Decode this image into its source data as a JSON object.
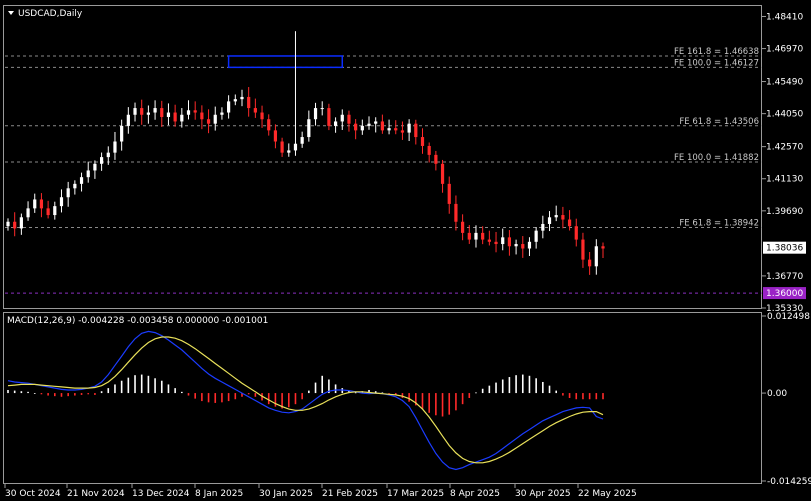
{
  "chart_data": [
    {
      "type": "candlestick",
      "symbol_label": "USDCAD,Daily",
      "ylim": [
        1.3533,
        1.4888
      ],
      "y_ticks": [
        "1.48410",
        "1.46970",
        "1.45490",
        "1.44050",
        "1.42570",
        "1.41130",
        "1.39690",
        "1.36770",
        "1.35330"
      ],
      "x_ticks": [
        "30 Oct 2024",
        "21 Nov 2024",
        "13 Dec 2024",
        "8 Jan 2025",
        "30 Jan 2025",
        "21 Feb 2025",
        "17 Mar 2025",
        "8 Apr 2025",
        "30 Apr 2025",
        "22 May 2025"
      ],
      "current_price": "1.38036",
      "level_marker": "1.36000",
      "fibonacci_levels": [
        {
          "label": "FE 161.8 = 1.46638",
          "value": 1.46638
        },
        {
          "label": "FE 100.0 = 1.46127",
          "value": 1.46127
        },
        {
          "label": "FE 61.8 = 1.43506",
          "value": 1.43506
        },
        {
          "label": "FE 100.0 = 1.41882",
          "value": 1.41882
        },
        {
          "label": "FE 61.8 = 1.38942",
          "value": 1.38942
        }
      ],
      "target_zone": {
        "from": 1.46127,
        "to": 1.46638
      },
      "close_path": [
        1.392,
        1.389,
        1.394,
        1.398,
        1.402,
        1.398,
        1.395,
        1.399,
        1.403,
        1.407,
        1.409,
        1.412,
        1.415,
        1.418,
        1.421,
        1.423,
        1.428,
        1.435,
        1.44,
        1.443,
        1.44,
        1.441,
        1.443,
        1.439,
        1.441,
        1.437,
        1.44,
        1.442,
        1.441,
        1.438,
        1.436,
        1.44,
        1.441,
        1.446,
        1.447,
        1.448,
        1.443,
        1.441,
        1.438,
        1.433,
        1.428,
        1.423,
        1.424,
        1.427,
        1.43,
        1.438,
        1.443,
        1.443,
        1.435,
        1.437,
        1.44,
        1.436,
        1.433,
        1.435,
        1.436,
        1.437,
        1.433,
        1.434,
        1.433,
        1.432,
        1.436,
        1.43,
        1.426,
        1.422,
        1.418,
        1.409,
        1.4,
        1.392,
        1.387,
        1.384,
        1.387,
        1.384,
        1.383,
        1.382,
        1.385,
        1.381,
        1.382,
        1.38,
        1.383,
        1.388,
        1.391,
        1.394,
        1.395,
        1.393,
        1.39,
        1.384,
        1.375,
        1.372,
        1.381,
        1.38
      ]
    },
    {
      "type": "line",
      "title": "MACD(12,26,9) -0.004228 -0.003458 0.000000 -0.001001",
      "y_ticks": [
        "0.012498",
        "0.00",
        "-0.014259"
      ],
      "ylim": [
        -0.014259,
        0.012498
      ],
      "series": [
        {
          "name": "MACD histogram",
          "values": [
            0.0005,
            0.0004,
            0.0003,
            0.0002,
            0.0,
            -0.0002,
            -0.0004,
            -0.0005,
            -0.0006,
            -0.0005,
            -0.0004,
            -0.0003,
            -0.0002,
            -0.0003,
            0.0003,
            0.0008,
            0.0014,
            0.002,
            0.0025,
            0.0029,
            0.003,
            0.0028,
            0.0024,
            0.002,
            0.0014,
            0.0008,
            0.0002,
            -0.0004,
            -0.0009,
            -0.0013,
            -0.0015,
            -0.0016,
            -0.0015,
            -0.0013,
            -0.001,
            -0.0006,
            -0.0002,
            -0.0006,
            -0.0012,
            -0.0018,
            -0.0022,
            -0.0025,
            -0.0023,
            -0.0018,
            -0.001,
            0.0004,
            0.0017,
            0.0028,
            0.0022,
            0.0014,
            0.0008,
            0.0004,
            0.0001,
            0.0003,
            0.0005,
            0.0003,
            0.0001,
            -0.0001,
            -0.0003,
            -0.0008,
            -0.0014,
            -0.002,
            -0.0026,
            -0.0032,
            -0.0036,
            -0.0038,
            -0.0035,
            -0.0028,
            -0.0018,
            -0.0008,
            0.0001,
            0.0007,
            0.0012,
            0.0017,
            0.0022,
            0.0026,
            0.0029,
            0.003,
            0.0028,
            0.0024,
            0.0018,
            0.0012,
            0.0004,
            -0.0004,
            -0.0008,
            -0.001,
            -0.001,
            -0.001,
            -0.001,
            -0.001
          ]
        },
        {
          "name": "MACD line",
          "values": [
            0.002,
            0.0018,
            0.0017,
            0.0016,
            0.0014,
            0.0012,
            0.001,
            0.0008,
            0.0006,
            0.0005,
            0.0005,
            0.0006,
            0.0008,
            0.0011,
            0.0018,
            0.003,
            0.0045,
            0.006,
            0.0075,
            0.0088,
            0.0097,
            0.01,
            0.0098,
            0.0093,
            0.0086,
            0.0078,
            0.007,
            0.006,
            0.005,
            0.004,
            0.0031,
            0.0024,
            0.0018,
            0.0012,
            0.0006,
            0.0,
            -0.0006,
            -0.0012,
            -0.0018,
            -0.0024,
            -0.0028,
            -0.0031,
            -0.0032,
            -0.003,
            -0.0026,
            -0.0018,
            -0.001,
            -0.0002,
            0.0003,
            0.0005,
            0.0005,
            0.0004,
            0.0002,
            0.0,
            -0.0001,
            0.0,
            -0.0001,
            -0.0003,
            -0.0006,
            -0.0012,
            -0.0022,
            -0.004,
            -0.006,
            -0.008,
            -0.0098,
            -0.0112,
            -0.0121,
            -0.0124,
            -0.0121,
            -0.0116,
            -0.0112,
            -0.0108,
            -0.0104,
            -0.0098,
            -0.009,
            -0.0082,
            -0.0074,
            -0.0066,
            -0.0059,
            -0.0052,
            -0.0045,
            -0.004,
            -0.0035,
            -0.003,
            -0.0027,
            -0.0024,
            -0.0023,
            -0.0024,
            -0.0038,
            -0.0042
          ]
        },
        {
          "name": "Signal line",
          "values": [
            0.0012,
            0.0013,
            0.0014,
            0.0014,
            0.0014,
            0.0013,
            0.0012,
            0.0011,
            0.001,
            0.0009,
            0.0008,
            0.0008,
            0.0008,
            0.0009,
            0.0012,
            0.0018,
            0.0027,
            0.0038,
            0.005,
            0.0062,
            0.0073,
            0.0082,
            0.0088,
            0.0091,
            0.0091,
            0.0089,
            0.0085,
            0.0079,
            0.0072,
            0.0064,
            0.0056,
            0.0048,
            0.004,
            0.0032,
            0.0024,
            0.0016,
            0.0009,
            0.0002,
            -0.0005,
            -0.0011,
            -0.0017,
            -0.0022,
            -0.0026,
            -0.0028,
            -0.0028,
            -0.0026,
            -0.0022,
            -0.0017,
            -0.0011,
            -0.0006,
            -0.0002,
            0.0001,
            0.0002,
            0.0002,
            0.0001,
            0.0,
            -0.0001,
            -0.0002,
            -0.0003,
            -0.0005,
            -0.0009,
            -0.0016,
            -0.0026,
            -0.0039,
            -0.0054,
            -0.007,
            -0.0085,
            -0.0097,
            -0.0106,
            -0.0111,
            -0.0113,
            -0.0113,
            -0.0111,
            -0.0107,
            -0.0102,
            -0.0096,
            -0.0089,
            -0.0082,
            -0.0075,
            -0.0068,
            -0.0061,
            -0.0054,
            -0.0048,
            -0.0043,
            -0.0038,
            -0.0034,
            -0.0031,
            -0.003,
            -0.003,
            -0.0035
          ]
        }
      ]
    }
  ],
  "colors": {
    "background": "#000000",
    "bull_candle": "#ffffff",
    "bear_candle": "#ff2a2a",
    "macd_line": "#1b3cff",
    "signal_line": "#e8e05a",
    "target_box": "#0a2cff",
    "level_label_bg": "#9a23c6",
    "dashed_level": "#8a8a8a"
  }
}
